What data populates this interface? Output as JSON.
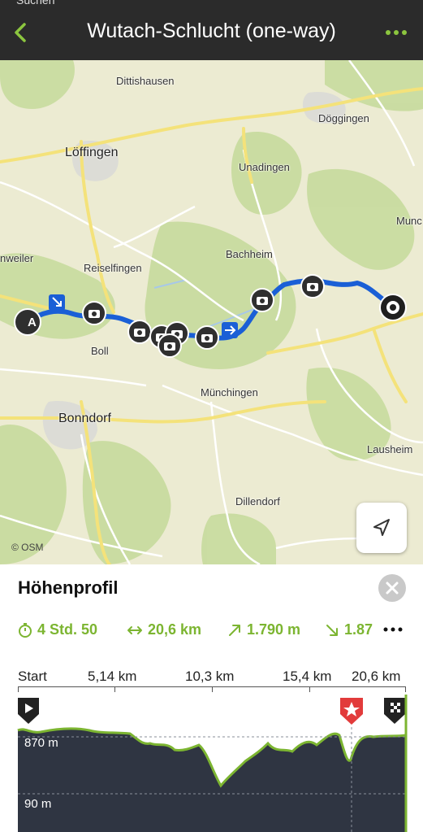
{
  "header": {
    "status_snippet": "Suchen",
    "title": "Wutach-Schlucht (one-way)"
  },
  "map": {
    "attribution": "© OSM",
    "start_marker": "A",
    "places": [
      {
        "id": "dittishausen",
        "name": "Dittishausen"
      },
      {
        "id": "doggingen",
        "name": "Döggingen"
      },
      {
        "id": "loffingen",
        "name": "Löffingen"
      },
      {
        "id": "unadingen",
        "name": "Unadingen"
      },
      {
        "id": "munch-edge",
        "name": "Munc"
      },
      {
        "id": "reiselfingen",
        "name": "Reiselfingen"
      },
      {
        "id": "bachheim",
        "name": "Bachheim"
      },
      {
        "id": "nweiler",
        "name": "nweiler"
      },
      {
        "id": "boll",
        "name": "Boll"
      },
      {
        "id": "munchingen",
        "name": "Münchingen"
      },
      {
        "id": "bonndorf",
        "name": "Bonndorf"
      },
      {
        "id": "lausheim",
        "name": "Lausheim"
      },
      {
        "id": "dillendorf",
        "name": "Dillendorf"
      }
    ]
  },
  "panel": {
    "title": "Höhenprofil",
    "stats": {
      "duration": "4 Std. 50",
      "distance": "20,6 km",
      "ascent": "1.790 m",
      "descent": "1.87"
    },
    "distance_axis": [
      "Start",
      "5,14 km",
      "10,3 km",
      "15,4 km",
      "20,6 km"
    ],
    "elevation_labels": {
      "top": "870 m",
      "bottom": "90 m"
    }
  },
  "colors": {
    "accent_green": "#7cb531",
    "route_blue": "#1a5fd6",
    "header_bg": "#2b2b2b",
    "profile_fill": "#2f3542",
    "start_flag_red": "#e23b3b"
  },
  "icons": {
    "back": "chevron-left-icon",
    "more": "more-dots-icon",
    "locate": "location-arrow-icon",
    "close": "close-icon",
    "duration": "stopwatch-icon",
    "distance": "horizontal-arrows-icon",
    "ascent": "arrow-up-right-icon",
    "descent": "arrow-down-right-icon"
  }
}
